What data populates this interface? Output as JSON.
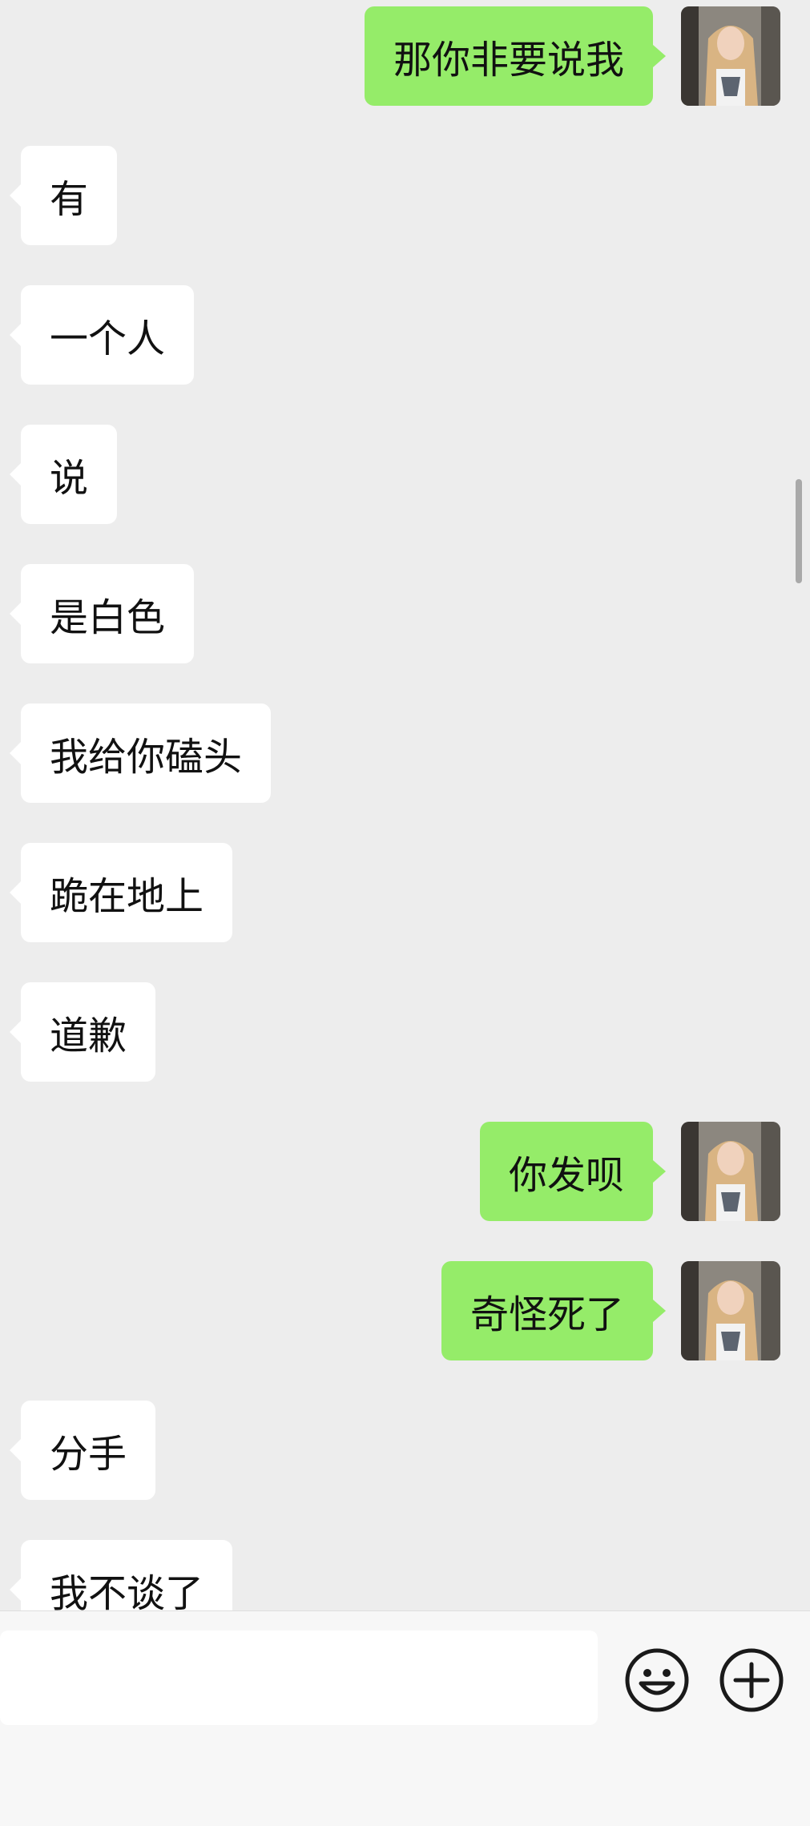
{
  "messages": [
    {
      "side": "out",
      "text": "那你非要说我"
    },
    {
      "side": "in",
      "text": "有"
    },
    {
      "side": "in",
      "text": "一个人"
    },
    {
      "side": "in",
      "text": "说"
    },
    {
      "side": "in",
      "text": "是白色"
    },
    {
      "side": "in",
      "text": "我给你磕头"
    },
    {
      "side": "in",
      "text": "跪在地上"
    },
    {
      "side": "in",
      "text": "道歉"
    },
    {
      "side": "out",
      "text": "你发呗"
    },
    {
      "side": "out",
      "text": "奇怪死了"
    },
    {
      "side": "in",
      "text": "分手"
    },
    {
      "side": "in",
      "text": "我不谈了"
    }
  ],
  "input": {
    "value": "",
    "placeholder": ""
  },
  "icons": {
    "emoji": "emoji-icon",
    "more": "plus-icon"
  },
  "colors": {
    "background": "#ededed",
    "incoming_bubble": "#ffffff",
    "outgoing_bubble": "#95ec69",
    "input_bar": "#f7f7f7"
  }
}
